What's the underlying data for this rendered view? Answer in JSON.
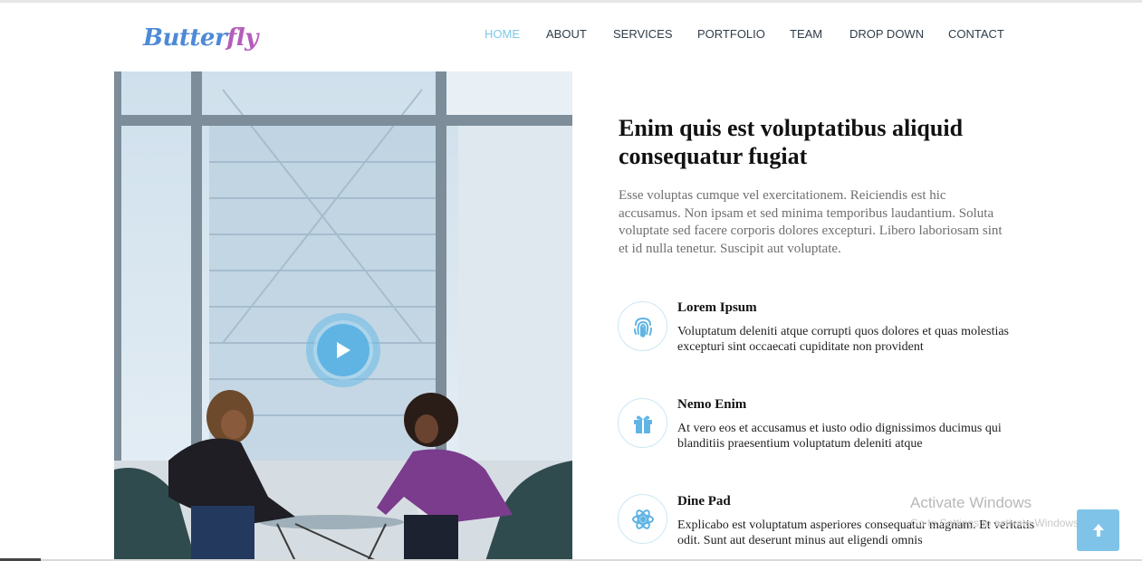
{
  "brand": {
    "logo_part1": "Butter",
    "logo_part2": "fly"
  },
  "nav": {
    "items": [
      {
        "label": "HOME",
        "active": true
      },
      {
        "label": "ABOUT"
      },
      {
        "label": "SERVICES"
      },
      {
        "label": "PORTFOLIO"
      },
      {
        "label": "TEAM"
      },
      {
        "label": "DROP DOWN"
      },
      {
        "label": "CONTACT"
      }
    ]
  },
  "about": {
    "title": "Enim quis est voluptatibus aliquid consequatur fugiat",
    "description": "Esse voluptas cumque vel exercitationem. Reiciendis est hic accusamus. Non ipsam et sed minima temporibus laudantium. Soluta voluptate sed facere corporis dolores excepturi. Libero laboriosam sint et id nulla tenetur. Suscipit aut voluptate.",
    "features": [
      {
        "icon": "fingerprint-icon",
        "title": "Lorem Ipsum",
        "text": "Voluptatum deleniti atque corrupti quos dolores et quas molestias excepturi sint occaecati cupiditate non provident"
      },
      {
        "icon": "gift-icon",
        "title": "Nemo Enim",
        "text": "At vero eos et accusamus et iusto odio dignissimos ducimus qui blanditiis praesentium voluptatum deleniti atque"
      },
      {
        "icon": "atom-icon",
        "title": "Dine Pad",
        "text": "Explicabo est voluptatum asperiores consequatur magnam. Et veritatis odit. Sunt aut deserunt minus aut eligendi omnis"
      }
    ]
  },
  "overlay": {
    "activate_title": "Activate Windows",
    "activate_sub": "Go to Settings to activate Windows."
  },
  "colors": {
    "accent": "#5fb4e4",
    "nav_active": "#7ec8e6",
    "nav_text": "#2f3d4a",
    "back_to_top": "#7fc4e8"
  }
}
